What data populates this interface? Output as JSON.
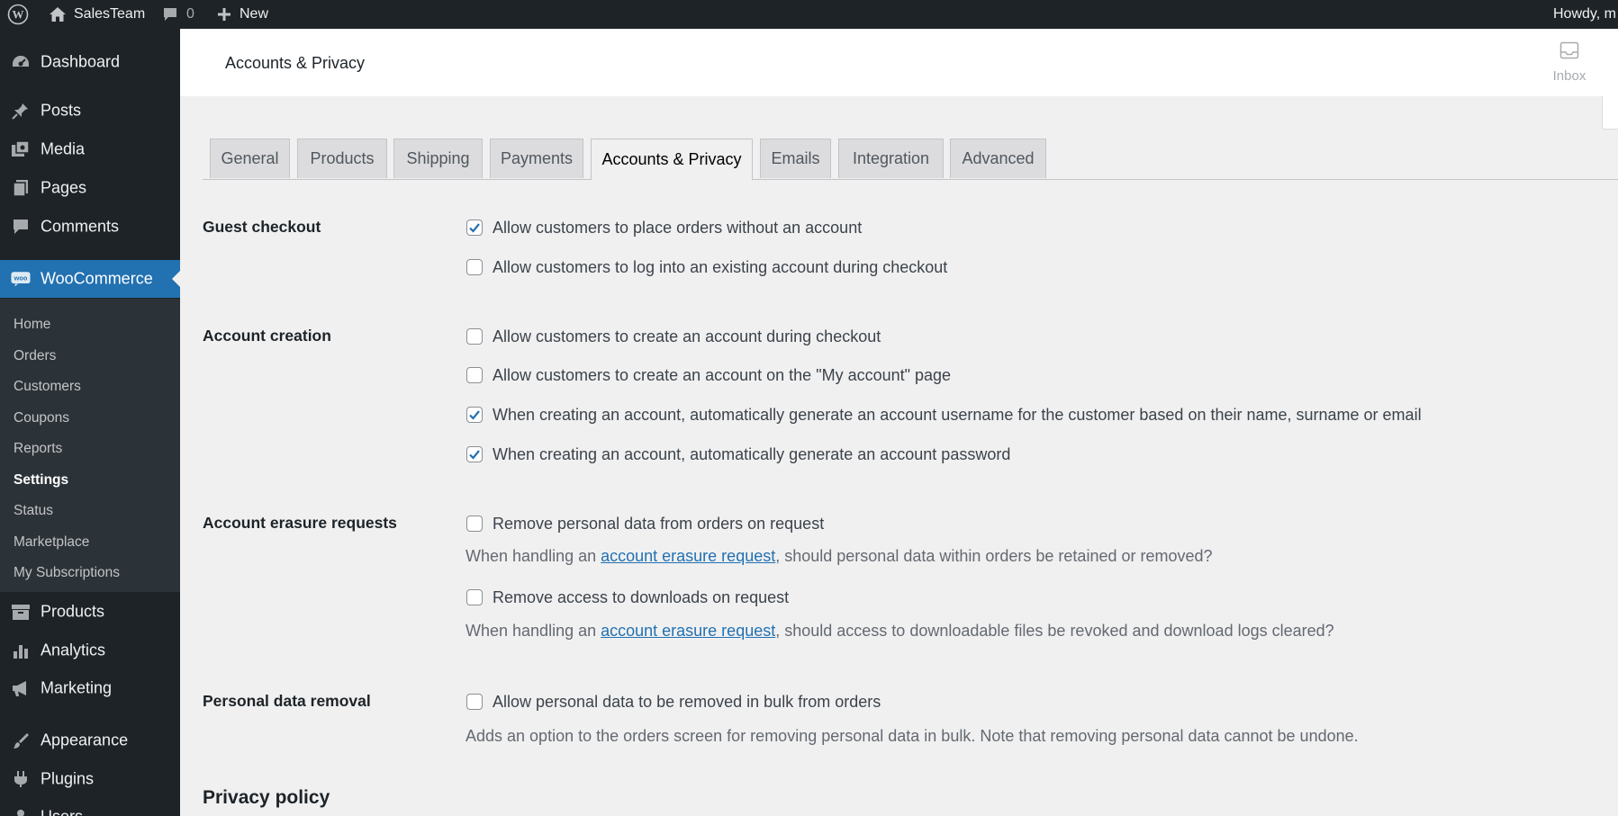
{
  "adminbar": {
    "site_name": "SalesTeam",
    "comments_count": "0",
    "new_label": "New",
    "howdy": "Howdy, m"
  },
  "sidebar": {
    "top": [
      {
        "label": "Dashboard",
        "icon": "dashboard-icon"
      },
      {
        "label": "Posts",
        "icon": "pin-icon"
      },
      {
        "label": "Media",
        "icon": "media-icon"
      },
      {
        "label": "Pages",
        "icon": "page-icon"
      },
      {
        "label": "Comments",
        "icon": "comment-icon"
      },
      {
        "label": "WooCommerce",
        "icon": "woocommerce-icon"
      }
    ],
    "submenu": [
      "Home",
      "Orders",
      "Customers",
      "Coupons",
      "Reports",
      "Settings",
      "Status",
      "Marketplace",
      "My Subscriptions"
    ],
    "bottom": [
      {
        "label": "Products",
        "icon": "archive-icon"
      },
      {
        "label": "Analytics",
        "icon": "bar-chart-icon"
      },
      {
        "label": "Marketing",
        "icon": "megaphone-icon"
      },
      {
        "label": "Appearance",
        "icon": "paintbrush-icon"
      },
      {
        "label": "Plugins",
        "icon": "plug-icon"
      },
      {
        "label": "Users",
        "icon": "users-icon"
      }
    ]
  },
  "header": {
    "title": "Accounts & Privacy",
    "inbox_label": "Inbox"
  },
  "tabs": [
    "General",
    "Products",
    "Shipping",
    "Payments",
    "Accounts & Privacy",
    "Emails",
    "Integration",
    "Advanced"
  ],
  "active_tab": "Accounts & Privacy",
  "form": {
    "guest_checkout": {
      "label": "Guest checkout",
      "options": [
        {
          "text": "Allow customers to place orders without an account",
          "checked": true
        },
        {
          "text": "Allow customers to log into an existing account during checkout",
          "checked": false
        }
      ]
    },
    "account_creation": {
      "label": "Account creation",
      "options": [
        {
          "text": "Allow customers to create an account during checkout",
          "checked": false
        },
        {
          "text": "Allow customers to create an account on the \"My account\" page",
          "checked": false
        },
        {
          "text": "When creating an account, automatically generate an account username for the customer based on their name, surname or email",
          "checked": true
        },
        {
          "text": "When creating an account, automatically generate an account password",
          "checked": true
        }
      ]
    },
    "erasure": {
      "label": "Account erasure requests",
      "options": [
        {
          "text": "Remove personal data from orders on request",
          "checked": false
        },
        {
          "text": "Remove access to downloads on request",
          "checked": false
        }
      ],
      "desc1": {
        "before": "When handling an ",
        "link": "account erasure request",
        "after": ", should personal data within orders be retained or removed?"
      },
      "desc2": {
        "before": "When handling an ",
        "link": "account erasure request",
        "after": ", should access to downloadable files be revoked and download logs cleared?"
      }
    },
    "personal_data": {
      "label": "Personal data removal",
      "options": [
        {
          "text": "Allow personal data to be removed in bulk from orders",
          "checked": false
        }
      ],
      "desc": "Adds an option to the orders screen for removing personal data in bulk. Note that removing personal data cannot be undone."
    },
    "privacy_policy_title": "Privacy policy"
  },
  "colors": {
    "adminbar": "#1d2327",
    "menu_highlight": "#2271b1",
    "submenu_bg": "#2c3338",
    "checkbox_check": "#2271b1",
    "link": "#2271b1"
  }
}
